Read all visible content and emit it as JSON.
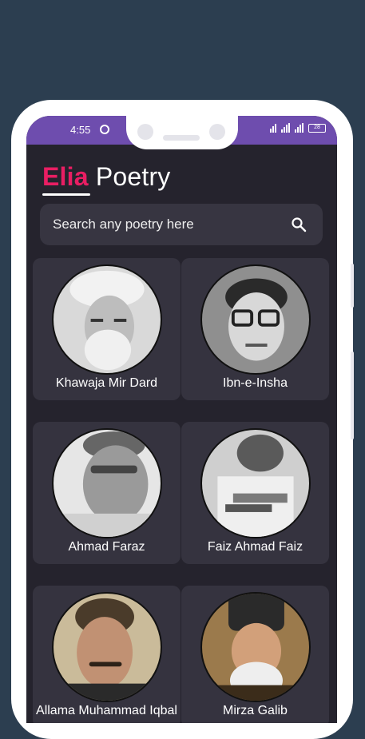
{
  "status_bar": {
    "time": "4:55",
    "battery": "28"
  },
  "app": {
    "title_accent": "Elia",
    "title_rest": "Poetry"
  },
  "search": {
    "placeholder": "Search any poetry here"
  },
  "poets": [
    {
      "name": "Khawaja Mir Dard"
    },
    {
      "name": "Ibn-e-Insha"
    },
    {
      "name": "Ahmad Faraz"
    },
    {
      "name": "Faiz Ahmad Faiz"
    },
    {
      "name": "Allama Muhammad Iqbal"
    },
    {
      "name": "Mirza Galib"
    }
  ],
  "colors": {
    "background": "#2c3e50",
    "status_bar": "#6e4dae",
    "accent": "#e91e63",
    "screen": "#25232d",
    "card": "#35333f"
  }
}
